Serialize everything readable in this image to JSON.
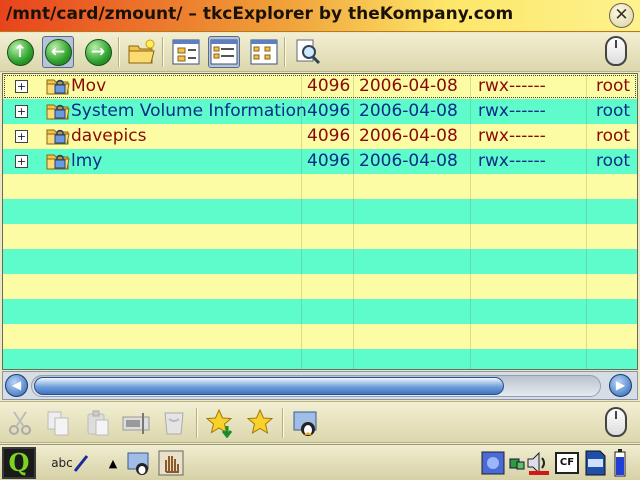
{
  "window": {
    "title": "/mnt/card/zmount/ – tkcExplorer by theKompany.com",
    "close_glyph": "✕"
  },
  "toolbar_top": {
    "buttons": [
      {
        "name": "go-up-icon",
        "glyph": "↑"
      },
      {
        "name": "back-icon",
        "glyph": "←"
      },
      {
        "name": "forward-icon",
        "glyph": "→"
      },
      {
        "name": "new-folder-icon"
      },
      {
        "name": "icon-view-icon"
      },
      {
        "name": "detail-view-icon",
        "pressed": true
      },
      {
        "name": "list-view-icon"
      },
      {
        "name": "find-icon"
      }
    ]
  },
  "files": [
    {
      "name": "Mov",
      "size": "4096",
      "date": "2006-04-08",
      "perms": "rwx------",
      "owner": "root",
      "expander": "+"
    },
    {
      "name": "System Volume Information",
      "size": "4096",
      "date": "2006-04-08",
      "perms": "rwx------",
      "owner": "root",
      "expander": "+"
    },
    {
      "name": "davepics",
      "size": "4096",
      "date": "2006-04-08",
      "perms": "rwx------",
      "owner": "root",
      "expander": "+"
    },
    {
      "name": "lmy",
      "size": "4096",
      "date": "2006-04-08",
      "perms": "rwx------",
      "owner": "root",
      "expander": "+"
    }
  ],
  "scrollbar": {
    "left_glyph": "◀",
    "right_glyph": "▶",
    "thumb_fraction": 0.83
  },
  "toolbar_bottom": {
    "buttons": [
      "cut-icon",
      "copy-icon",
      "paste-icon",
      "rename-icon",
      "delete-icon",
      "add-bookmark-icon",
      "bookmarks-icon",
      "network-icon"
    ]
  },
  "taskbar": {
    "start_glyph": "Q",
    "input_label": "abc",
    "up_arrow": "▲",
    "cf_label": "CF"
  },
  "colors": {
    "row_even": "#fcfca4",
    "row_odd": "#5efcca",
    "text_even": "#8c0808",
    "text_odd": "#0c2a8c"
  }
}
